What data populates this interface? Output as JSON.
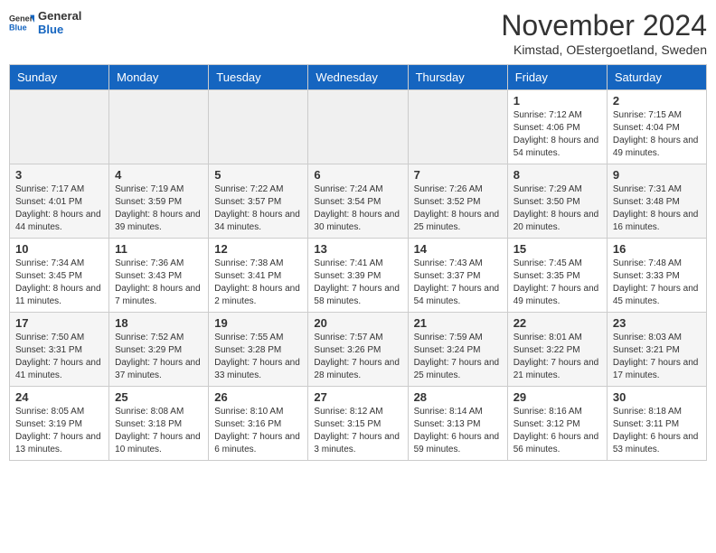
{
  "logo": {
    "general": "General",
    "blue": "Blue"
  },
  "title": "November 2024",
  "location": "Kimstad, OEstergoetland, Sweden",
  "days_of_week": [
    "Sunday",
    "Monday",
    "Tuesday",
    "Wednesday",
    "Thursday",
    "Friday",
    "Saturday"
  ],
  "weeks": [
    [
      {
        "day": "",
        "info": ""
      },
      {
        "day": "",
        "info": ""
      },
      {
        "day": "",
        "info": ""
      },
      {
        "day": "",
        "info": ""
      },
      {
        "day": "",
        "info": ""
      },
      {
        "day": "1",
        "info": "Sunrise: 7:12 AM\nSunset: 4:06 PM\nDaylight: 8 hours and 54 minutes."
      },
      {
        "day": "2",
        "info": "Sunrise: 7:15 AM\nSunset: 4:04 PM\nDaylight: 8 hours and 49 minutes."
      }
    ],
    [
      {
        "day": "3",
        "info": "Sunrise: 7:17 AM\nSunset: 4:01 PM\nDaylight: 8 hours and 44 minutes."
      },
      {
        "day": "4",
        "info": "Sunrise: 7:19 AM\nSunset: 3:59 PM\nDaylight: 8 hours and 39 minutes."
      },
      {
        "day": "5",
        "info": "Sunrise: 7:22 AM\nSunset: 3:57 PM\nDaylight: 8 hours and 34 minutes."
      },
      {
        "day": "6",
        "info": "Sunrise: 7:24 AM\nSunset: 3:54 PM\nDaylight: 8 hours and 30 minutes."
      },
      {
        "day": "7",
        "info": "Sunrise: 7:26 AM\nSunset: 3:52 PM\nDaylight: 8 hours and 25 minutes."
      },
      {
        "day": "8",
        "info": "Sunrise: 7:29 AM\nSunset: 3:50 PM\nDaylight: 8 hours and 20 minutes."
      },
      {
        "day": "9",
        "info": "Sunrise: 7:31 AM\nSunset: 3:48 PM\nDaylight: 8 hours and 16 minutes."
      }
    ],
    [
      {
        "day": "10",
        "info": "Sunrise: 7:34 AM\nSunset: 3:45 PM\nDaylight: 8 hours and 11 minutes."
      },
      {
        "day": "11",
        "info": "Sunrise: 7:36 AM\nSunset: 3:43 PM\nDaylight: 8 hours and 7 minutes."
      },
      {
        "day": "12",
        "info": "Sunrise: 7:38 AM\nSunset: 3:41 PM\nDaylight: 8 hours and 2 minutes."
      },
      {
        "day": "13",
        "info": "Sunrise: 7:41 AM\nSunset: 3:39 PM\nDaylight: 7 hours and 58 minutes."
      },
      {
        "day": "14",
        "info": "Sunrise: 7:43 AM\nSunset: 3:37 PM\nDaylight: 7 hours and 54 minutes."
      },
      {
        "day": "15",
        "info": "Sunrise: 7:45 AM\nSunset: 3:35 PM\nDaylight: 7 hours and 49 minutes."
      },
      {
        "day": "16",
        "info": "Sunrise: 7:48 AM\nSunset: 3:33 PM\nDaylight: 7 hours and 45 minutes."
      }
    ],
    [
      {
        "day": "17",
        "info": "Sunrise: 7:50 AM\nSunset: 3:31 PM\nDaylight: 7 hours and 41 minutes."
      },
      {
        "day": "18",
        "info": "Sunrise: 7:52 AM\nSunset: 3:29 PM\nDaylight: 7 hours and 37 minutes."
      },
      {
        "day": "19",
        "info": "Sunrise: 7:55 AM\nSunset: 3:28 PM\nDaylight: 7 hours and 33 minutes."
      },
      {
        "day": "20",
        "info": "Sunrise: 7:57 AM\nSunset: 3:26 PM\nDaylight: 7 hours and 28 minutes."
      },
      {
        "day": "21",
        "info": "Sunrise: 7:59 AM\nSunset: 3:24 PM\nDaylight: 7 hours and 25 minutes."
      },
      {
        "day": "22",
        "info": "Sunrise: 8:01 AM\nSunset: 3:22 PM\nDaylight: 7 hours and 21 minutes."
      },
      {
        "day": "23",
        "info": "Sunrise: 8:03 AM\nSunset: 3:21 PM\nDaylight: 7 hours and 17 minutes."
      }
    ],
    [
      {
        "day": "24",
        "info": "Sunrise: 8:05 AM\nSunset: 3:19 PM\nDaylight: 7 hours and 13 minutes."
      },
      {
        "day": "25",
        "info": "Sunrise: 8:08 AM\nSunset: 3:18 PM\nDaylight: 7 hours and 10 minutes."
      },
      {
        "day": "26",
        "info": "Sunrise: 8:10 AM\nSunset: 3:16 PM\nDaylight: 7 hours and 6 minutes."
      },
      {
        "day": "27",
        "info": "Sunrise: 8:12 AM\nSunset: 3:15 PM\nDaylight: 7 hours and 3 minutes."
      },
      {
        "day": "28",
        "info": "Sunrise: 8:14 AM\nSunset: 3:13 PM\nDaylight: 6 hours and 59 minutes."
      },
      {
        "day": "29",
        "info": "Sunrise: 8:16 AM\nSunset: 3:12 PM\nDaylight: 6 hours and 56 minutes."
      },
      {
        "day": "30",
        "info": "Sunrise: 8:18 AM\nSunset: 3:11 PM\nDaylight: 6 hours and 53 minutes."
      }
    ]
  ]
}
